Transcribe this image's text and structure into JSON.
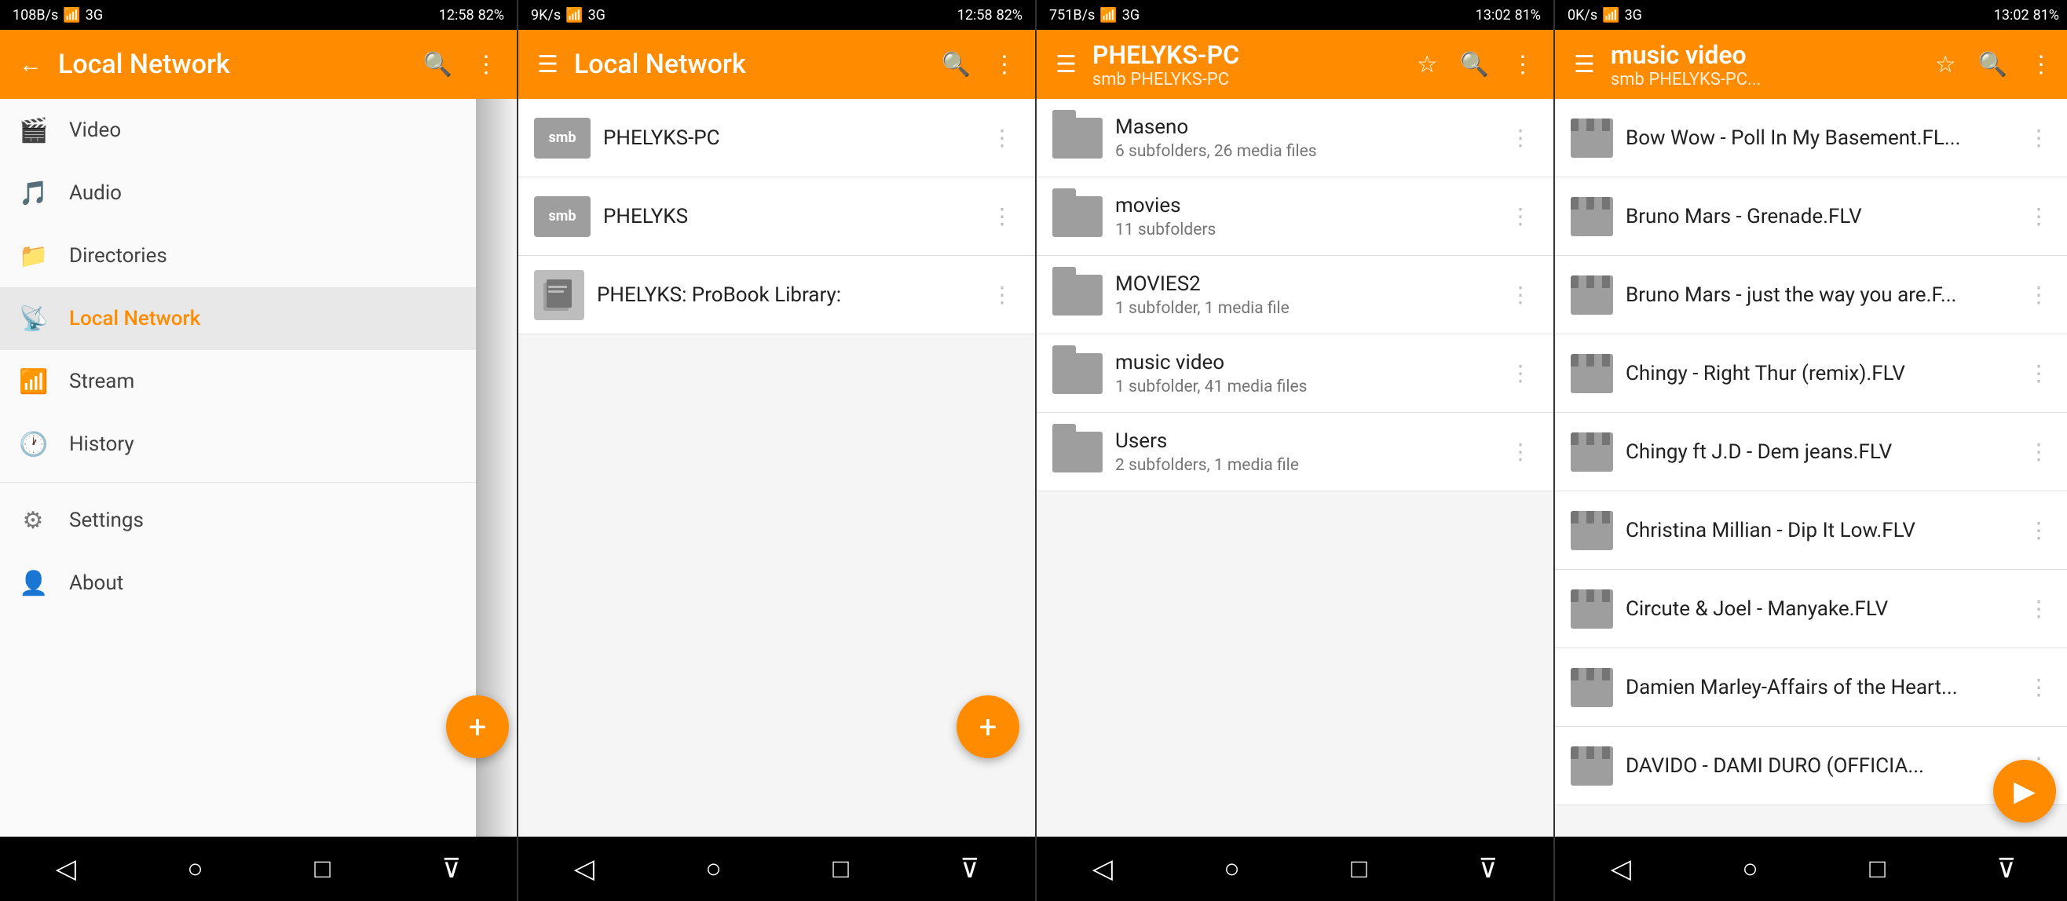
{
  "panels": [
    {
      "id": "panel1",
      "type": "drawer",
      "statusBar": {
        "left": "108B/s",
        "time": "12:58",
        "battery": "82%"
      },
      "toolbar": {
        "title": "Local Network",
        "type": "simple"
      },
      "navItems": [
        {
          "id": "video",
          "label": "Video",
          "icon": "🎬",
          "active": false
        },
        {
          "id": "audio",
          "label": "Audio",
          "icon": "🎵",
          "active": false
        },
        {
          "id": "directories",
          "label": "Directories",
          "icon": "📁",
          "active": false
        },
        {
          "id": "local-network",
          "label": "Local Network",
          "icon": "📡",
          "active": true
        },
        {
          "id": "stream",
          "label": "Stream",
          "icon": "📶",
          "active": false
        },
        {
          "id": "history",
          "label": "History",
          "icon": "🕐",
          "active": false
        },
        {
          "id": "settings",
          "label": "Settings",
          "icon": "⚙️",
          "active": false
        },
        {
          "id": "about",
          "label": "About",
          "icon": "👤",
          "active": false
        }
      ],
      "fab": "+"
    },
    {
      "id": "panel2",
      "type": "list",
      "statusBar": {
        "left": "9K/s",
        "time": "12:58",
        "battery": "82%"
      },
      "toolbar": {
        "title": "Local Network",
        "type": "simple"
      },
      "items": [
        {
          "id": "phelyks-pc",
          "type": "smb",
          "badge": "smb",
          "title": "PHELYKS-PC",
          "sub": ""
        },
        {
          "id": "phelyks",
          "type": "smb",
          "badge": "smb",
          "title": "PHELYKS",
          "sub": ""
        },
        {
          "id": "probook",
          "type": "img",
          "title": "PHELYKS: ProBook Library:",
          "sub": ""
        }
      ],
      "fab": "+"
    },
    {
      "id": "panel3",
      "type": "list",
      "statusBar": {
        "left": "751B/s",
        "time": "13:02",
        "battery": "81%"
      },
      "toolbar": {
        "title": "PHELYKS-PC",
        "subtitle": "smb PHELYKS-PC",
        "type": "detail"
      },
      "items": [
        {
          "id": "maseno",
          "type": "folder",
          "title": "Maseno",
          "sub": "6 subfolders, 26 media files"
        },
        {
          "id": "movies",
          "type": "folder",
          "title": "movies",
          "sub": "11 subfolders"
        },
        {
          "id": "movies2",
          "type": "folder",
          "title": "MOVIES2",
          "sub": "1 subfolder, 1 media file"
        },
        {
          "id": "music-video",
          "type": "folder",
          "title": "music video",
          "sub": "1 subfolder, 41 media files"
        },
        {
          "id": "users",
          "type": "folder",
          "title": "Users",
          "sub": "2 subfolders, 1 media file"
        }
      ]
    },
    {
      "id": "panel4",
      "type": "list",
      "statusBar": {
        "left": "0K/s",
        "time": "13:02",
        "battery": "81%"
      },
      "toolbar": {
        "title": "music video",
        "subtitle": "smb PHELYKS-PC...",
        "type": "detail"
      },
      "items": [
        {
          "id": "bowwow",
          "type": "video",
          "title": "Bow Wow - Poll In  My Basement.FL...",
          "sub": ""
        },
        {
          "id": "brunomars1",
          "type": "video",
          "title": "Bruno Mars - Grenade.FLV",
          "sub": ""
        },
        {
          "id": "brunomars2",
          "type": "video",
          "title": "Bruno Mars - just the way you are.F...",
          "sub": ""
        },
        {
          "id": "chingy1",
          "type": "video",
          "title": "Chingy - Right Thur (remix).FLV",
          "sub": ""
        },
        {
          "id": "chingy2",
          "type": "video",
          "title": "Chingy ft J.D - Dem jeans.FLV",
          "sub": ""
        },
        {
          "id": "christina",
          "type": "video",
          "title": "Christina Millian - Dip It Low.FLV",
          "sub": ""
        },
        {
          "id": "circute",
          "type": "video",
          "title": "Circute & Joel - Manyake.FLV",
          "sub": ""
        },
        {
          "id": "damien",
          "type": "video",
          "title": "Damien Marley-Affairs of the Heart...",
          "sub": ""
        },
        {
          "id": "davido",
          "type": "video",
          "title": "DAVIDO - DAMI DURO (OFFICIA...",
          "sub": ""
        }
      ],
      "fabPlay": "▶"
    }
  ],
  "bottomBar": {
    "icons": [
      "◁",
      "○",
      "□",
      "⊽"
    ]
  }
}
